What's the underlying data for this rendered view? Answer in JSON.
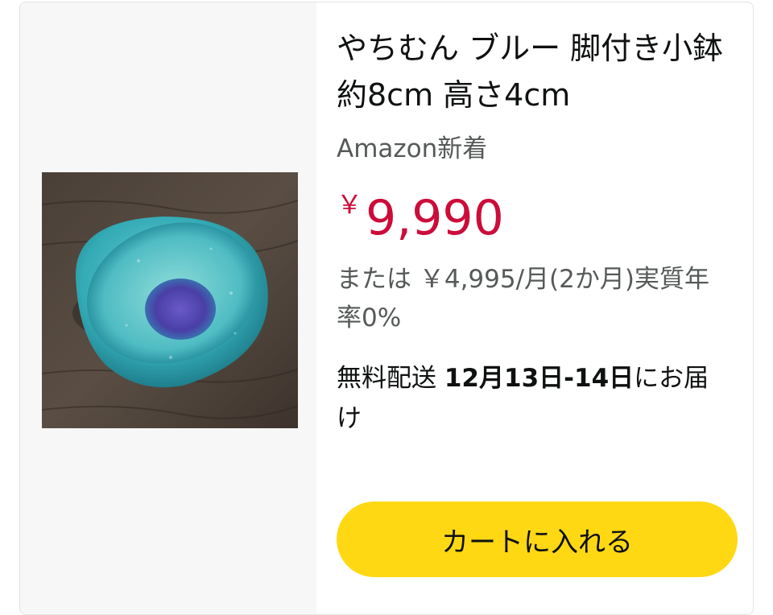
{
  "product": {
    "image_icon": "blue-bowl-photo",
    "title": "やちむん ブルー 脚付き小鉢 約8cm 高さ4cm",
    "seller": "Amazon新着",
    "price": {
      "currency": "￥",
      "amount": "9,990"
    },
    "installment": "または ￥4,995/月(2か月)実質年率0%",
    "delivery": {
      "prefix": "無料配送 ",
      "dates": "12月13日-14日",
      "suffix": "にお届け"
    },
    "cart_button_label": "カートに入れる"
  },
  "colors": {
    "price": "#cc0c39",
    "button": "#ffd814",
    "image_pane": "#f7f7f7"
  }
}
